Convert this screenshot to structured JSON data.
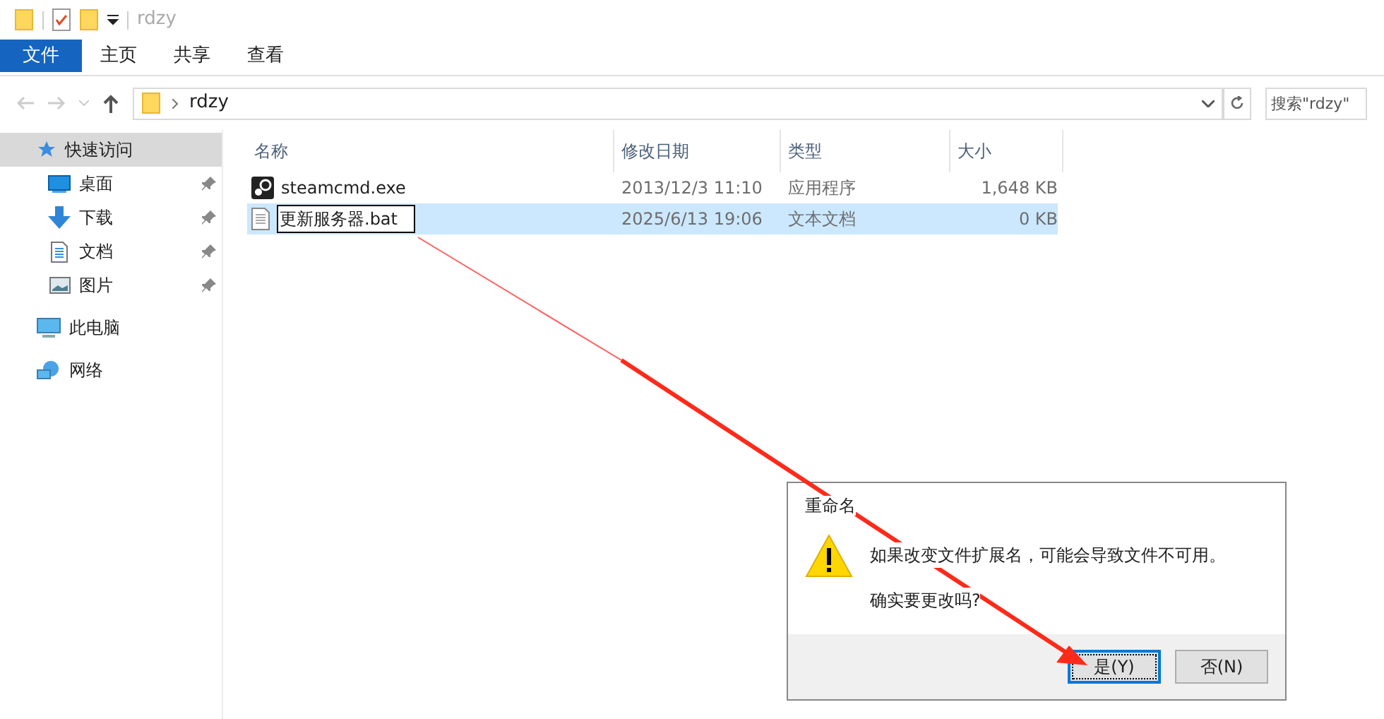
{
  "window": {
    "title": "rdzy"
  },
  "ribbon_tabs": [
    {
      "label": "文件",
      "selected": true
    },
    {
      "label": "主页",
      "selected": false
    },
    {
      "label": "共享",
      "selected": false
    },
    {
      "label": "查看",
      "selected": false
    }
  ],
  "address_bar": {
    "path": "rdzy"
  },
  "search": {
    "placeholder": "搜索\"rdzy\""
  },
  "sidebar": {
    "items": [
      {
        "label": "快速访问",
        "kind": "star",
        "selected": true,
        "children": [
          {
            "label": "桌面",
            "kind": "desktop",
            "pinned": true
          },
          {
            "label": "下载",
            "kind": "download",
            "pinned": true
          },
          {
            "label": "文档",
            "kind": "document",
            "pinned": true
          },
          {
            "label": "图片",
            "kind": "pictures",
            "pinned": true
          }
        ]
      },
      {
        "label": "此电脑",
        "kind": "computer",
        "selected": false
      },
      {
        "label": "网络",
        "kind": "network",
        "selected": false
      }
    ]
  },
  "table": {
    "columns": [
      "名称",
      "修改日期",
      "类型",
      "大小"
    ],
    "rows": [
      {
        "kind": "exe",
        "name": "steamcmd.exe",
        "modified": "2013/12/3 11:10",
        "type": "应用程序",
        "size": "1,648 KB",
        "selected": false,
        "renaming": false
      },
      {
        "kind": "text",
        "name": "更新服务器.bat",
        "modified": "2025/6/13 19:06",
        "type": "文本文档",
        "size": "0 KB",
        "selected": true,
        "renaming": true
      }
    ]
  },
  "dialog": {
    "title": "重命名",
    "message": "如果改变文件扩展名，可能会导致文件不可用。",
    "question": "确实要更改吗?",
    "buttons": [
      {
        "label": "是(Y)",
        "selected": true
      },
      {
        "label": "否(N)",
        "selected": false
      }
    ]
  }
}
